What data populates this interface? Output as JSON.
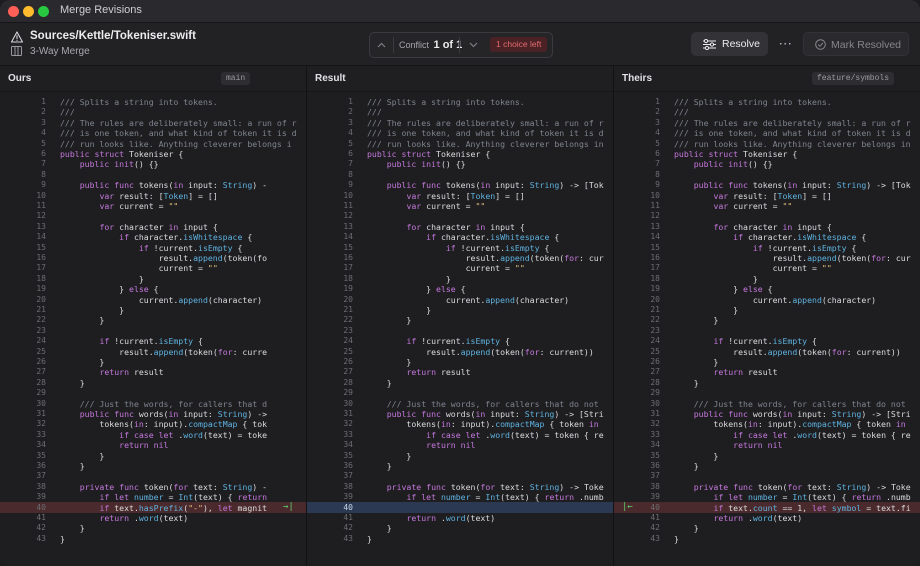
{
  "window": {
    "title": "Merge Revisions"
  },
  "toolbar": {
    "file_path": "Sources/Kettle/Tokeniser.swift",
    "mode": "3-Way Merge",
    "conflict_label": "Conflict",
    "conflict_position": "1 of 1",
    "choices_left": "1 choice left",
    "resolve_label": "Resolve",
    "more_label": "···",
    "mark_resolved_label": "Mark Resolved"
  },
  "panes": {
    "ours": {
      "title": "Ours",
      "branch": "main"
    },
    "result": {
      "title": "Result"
    },
    "theirs": {
      "title": "Theirs",
      "branch": "feature/symbols"
    }
  },
  "colors": {
    "conflict_ours": "#4a2a2c",
    "conflict_result": "#2b3a52",
    "conflict_theirs": "#4a2a2c",
    "arrow": "#5fd16a"
  },
  "icons": {
    "warning": "warning-icon",
    "columns": "three-columns-icon",
    "resolve": "sliders-icon",
    "mark": "check-circle-icon",
    "prev": "chevron-up-icon",
    "next": "chevron-down-icon",
    "accept_ours": "arrow-right-to-bar-icon",
    "accept_theirs": "arrow-left-to-bar-icon"
  },
  "conflict_line": 40,
  "code": {
    "ours": [
      "/// Splits a string into tokens.",
      "///",
      "/// The rules are deliberately small: a run of r",
      "/// is one token, and what kind of token it is d",
      "/// run looks like. Anything cleverer belongs i",
      "public struct Tokeniser {",
      "    public init() {}",
      "",
      "    public func tokens(in input: String) -",
      "        var result: [Token] = []",
      "        var current = \"\"",
      "",
      "        for character in input {",
      "            if character.isWhitespace {",
      "                if !current.isEmpty {",
      "                    result.append(token(fo",
      "                    current = \"\"",
      "                }",
      "            } else {",
      "                current.append(character)",
      "            }",
      "        }",
      "",
      "        if !current.isEmpty {",
      "            result.append(token(for: curre",
      "        }",
      "        return result",
      "    }",
      "",
      "    /// Just the words, for callers that d",
      "    public func words(in input: String) ->",
      "        tokens(in: input).compactMap { tok",
      "            if case let .word(text) = toke",
      "            return nil",
      "        }",
      "    }",
      "",
      "    private func token(for text: String) -",
      "        if let number = Int(text) { return",
      "        if text.hasPrefix(\"-\"), let magnit",
      "        return .word(text)",
      "    }",
      "}"
    ],
    "result": [
      "/// Splits a string into tokens.",
      "///",
      "/// The rules are deliberately small: a run of r",
      "/// is one token, and what kind of token it is d",
      "/// run looks like. Anything cleverer belongs in",
      "public struct Tokeniser {",
      "    public init() {}",
      "",
      "    public func tokens(in input: String) -> [Tok",
      "        var result: [Token] = []",
      "        var current = \"\"",
      "",
      "        for character in input {",
      "            if character.isWhitespace {",
      "                if !current.isEmpty {",
      "                    result.append(token(for: cur",
      "                    current = \"\"",
      "                }",
      "            } else {",
      "                current.append(character)",
      "            }",
      "        }",
      "",
      "        if !current.isEmpty {",
      "            result.append(token(for: current))",
      "        }",
      "        return result",
      "    }",
      "",
      "    /// Just the words, for callers that do not",
      "    public func words(in input: String) -> [Stri",
      "        tokens(in: input).compactMap { token in",
      "            if case let .word(text) = token { re",
      "            return nil",
      "        }",
      "    }",
      "",
      "    private func token(for text: String) -> Toke",
      "        if let number = Int(text) { return .numb",
      "",
      "        return .word(text)",
      "    }",
      "}"
    ],
    "theirs": [
      "/// Splits a string into tokens.",
      "///",
      "/// The rules are deliberately small: a run of r",
      "/// is one token, and what kind of token it is d",
      "/// run looks like. Anything cleverer belongs in",
      "public struct Tokeniser {",
      "    public init() {}",
      "",
      "    public func tokens(in input: String) -> [Tok",
      "        var result: [Token] = []",
      "        var current = \"\"",
      "",
      "        for character in input {",
      "            if character.isWhitespace {",
      "                if !current.isEmpty {",
      "                    result.append(token(for: cur",
      "                    current = \"\"",
      "                }",
      "            } else {",
      "                current.append(character)",
      "            }",
      "        }",
      "",
      "        if !current.isEmpty {",
      "            result.append(token(for: current))",
      "        }",
      "        return result",
      "    }",
      "",
      "    /// Just the words, for callers that do not",
      "    public func words(in input: String) -> [Stri",
      "        tokens(in: input).compactMap { token in",
      "            if case let .word(text) = token { re",
      "            return nil",
      "        }",
      "    }",
      "",
      "    private func token(for text: String) -> Toke",
      "        if let number = Int(text) { return .numb",
      "        if text.count == 1, let symbol = text.fi",
      "        return .word(text)",
      "    }",
      "}"
    ]
  }
}
